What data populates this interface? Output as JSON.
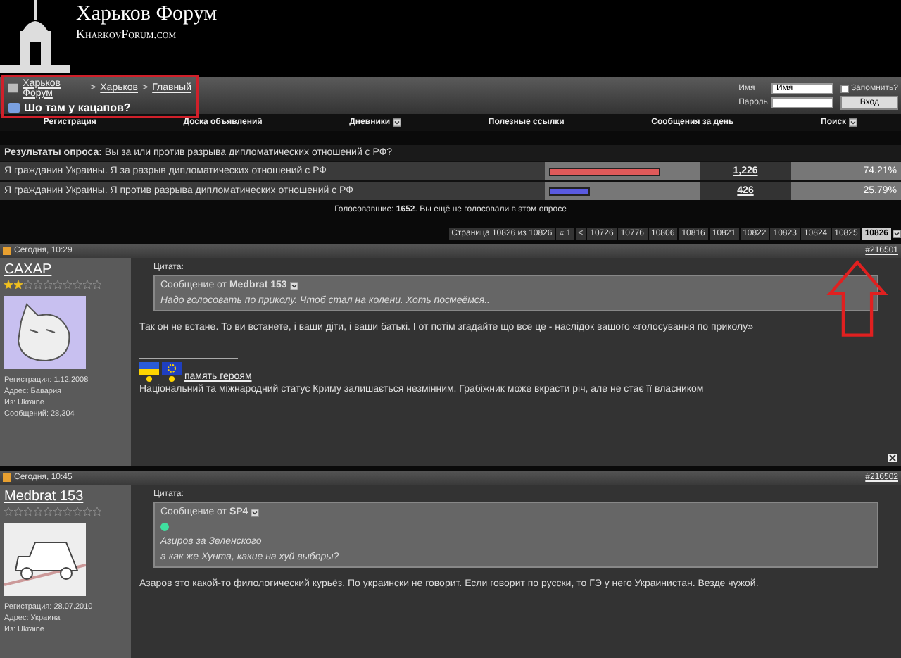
{
  "header": {
    "title": "Харьков Форум",
    "subtitle": "KharkovForum.com"
  },
  "breadcrumb": {
    "links": [
      "Харьков Форум",
      "Харьков",
      "Главный"
    ],
    "separator": ">",
    "current": "Шо там у кацапов?"
  },
  "login": {
    "name_label": "Имя",
    "name_value": "Имя",
    "remember_label": "Запомнить?",
    "remember_checked": false,
    "password_label": "Пароль",
    "submit": "Вход"
  },
  "menu": [
    {
      "label": "Регистрация",
      "dropdown": false
    },
    {
      "label": "Доска объявлений",
      "dropdown": false
    },
    {
      "label": "Дневники",
      "dropdown": true
    },
    {
      "label": "Полезные ссылки",
      "dropdown": false
    },
    {
      "label": "Сообщения за день",
      "dropdown": false
    },
    {
      "label": "Поиск",
      "dropdown": true
    }
  ],
  "poll": {
    "title_label": "Результаты опроса:",
    "question": "Вы за или против разрыва дипломатических отношений с РФ?",
    "options": [
      {
        "label": "Я гражданин Украины. Я за разрыв дипломатических отношений с РФ",
        "level": 0.7421,
        "color": "#e05a5a",
        "votes": "1,226",
        "percent": "74.21%"
      },
      {
        "label": "Я гражданин Украины. Я против разрыва дипломатических отношений с РФ",
        "level": 0.2579,
        "color": "#5a5ae0",
        "votes": "426",
        "percent": "25.79%"
      }
    ],
    "summary": "Голосовавшие: **1652**. Вы ещё не голосовали в этом опросе"
  },
  "pagination": {
    "label": "Страница 10826 из 10826",
    "pages": [
      {
        "label": "« 1",
        "selected": false
      },
      {
        "label": "<",
        "selected": false
      },
      {
        "label": "10726",
        "selected": false
      },
      {
        "label": "10776",
        "selected": false
      },
      {
        "label": "10806",
        "selected": false
      },
      {
        "label": "10816",
        "selected": false
      },
      {
        "label": "10821",
        "selected": false
      },
      {
        "label": "10822",
        "selected": false
      },
      {
        "label": "10823",
        "selected": false
      },
      {
        "label": "10824",
        "selected": false
      },
      {
        "label": "10825",
        "selected": false
      },
      {
        "label": "10826",
        "selected": true
      }
    ]
  },
  "posts": [
    {
      "date": "Сегодня, 10:29",
      "number": "#216501",
      "user": {
        "name": "САХАР",
        "stars": 2,
        "avatar": {
          "kind": "cat"
        },
        "details": [
          "Регистрация: 1.12.2008",
          "Адрес: Бавария",
          "Из: Ukraine",
          "Сообщений: 28,304"
        ]
      },
      "blocks": [
        {
          "kind": "quote",
          "label": "Цитата:",
          "from": "Сообщение от **Medbrat 153**",
          "lines": [
            {
              "kind": "text",
              "text": "Надо голосовать по приколу. Чтоб стал на колени. Хоть посмеёмся.."
            }
          ]
        },
        {
          "kind": "text",
          "text": "Так он не встане. То ви встанете, і ваши діти, і ваши батькі. І от потім згадайте що все це - наслідок вашого «голосування по приколу»"
        },
        {
          "kind": "signature",
          "link": "память героям",
          "text": "Національний та міжнародний статус Криму залишається незмінним. Грабіжник може вкрасти річ, але не стає її власником"
        }
      ]
    },
    {
      "date": "Сегодня, 10:45",
      "number": "#216502",
      "user": {
        "name": "Medbrat 153",
        "stars": 0,
        "avatar": {
          "kind": "car"
        },
        "details": [
          "Регистрация: 28.07.2010",
          "Адрес: Украина",
          "Из: Ukraine"
        ]
      },
      "blocks": [
        {
          "kind": "quote",
          "label": "Цитата:",
          "from": "Сообщение от **SP4**",
          "lines": [
            {
              "kind": "dot",
              "color": "#40e0a0"
            },
            {
              "kind": "text",
              "text": "Азиров за Зеленского"
            },
            {
              "kind": "text",
              "text": "а как же Хунта, какие на хуй выборы?"
            }
          ]
        },
        {
          "kind": "text",
          "text": "Азаров это какой-то филологический курьёз. По украински не говорит. Если говорит по русски, то ГЭ у него Украинистан. Везде чужой."
        }
      ]
    }
  ]
}
